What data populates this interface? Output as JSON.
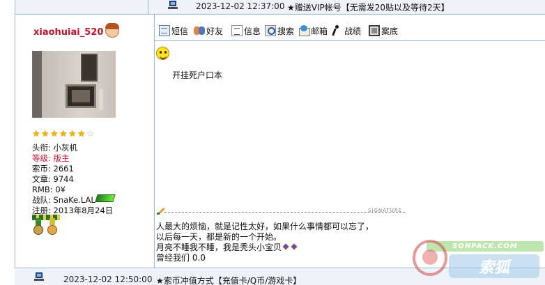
{
  "prev_post": {
    "timestamp": "2023-12-02 12:37:00",
    "title": "★赠送VIP帐号【无需发20贴以及等待2天】"
  },
  "author": {
    "username": "xiaohuiai_520",
    "rating": {
      "filled": 6,
      "total": 7
    },
    "title_label": "头衔:",
    "title_value": "小灰机",
    "level_label": "等级:",
    "level_value": "版主",
    "coins_label": "索币:",
    "coins_value": "2661",
    "posts_label": "文章:",
    "posts_value": "9744",
    "rmb_label": "RMB:",
    "rmb_value": "0¥",
    "team_label": "战队:",
    "team_value": "SnaKe.LAL",
    "register_label": "注册:",
    "register_value": "2013年8月24日"
  },
  "toolbar": {
    "items": [
      {
        "label": "短信",
        "icon": "message-icon"
      },
      {
        "label": "好友",
        "icon": "friends-icon"
      },
      {
        "label": "信息",
        "icon": "info-icon"
      },
      {
        "label": "搜索",
        "icon": "search-icon"
      },
      {
        "label": "邮箱",
        "icon": "mailbox-icon"
      },
      {
        "label": "战绩",
        "icon": "record-icon"
      },
      {
        "label": "案底",
        "icon": "record-file-icon"
      }
    ]
  },
  "post": {
    "emoticon": "smiley-icon",
    "body": "开挂死户口本"
  },
  "signature": {
    "label": "SIGNATURE",
    "lines": [
      "人最大的烦恼，就是记性太好，如果什么事情都可以忘了，",
      "以后每一天，都是新的一个开始。",
      "月亮不睡我不睡，我是秃头小宝贝",
      "曾经我们  0.0"
    ]
  },
  "next_post": {
    "timestamp": "2023-12-02 12:50:00",
    "title": "★索币冲值方式【充值卡/Q币/游戏卡】"
  },
  "watermark": {
    "band_text": "SONPACK.COM",
    "logo_text": "索狐"
  }
}
